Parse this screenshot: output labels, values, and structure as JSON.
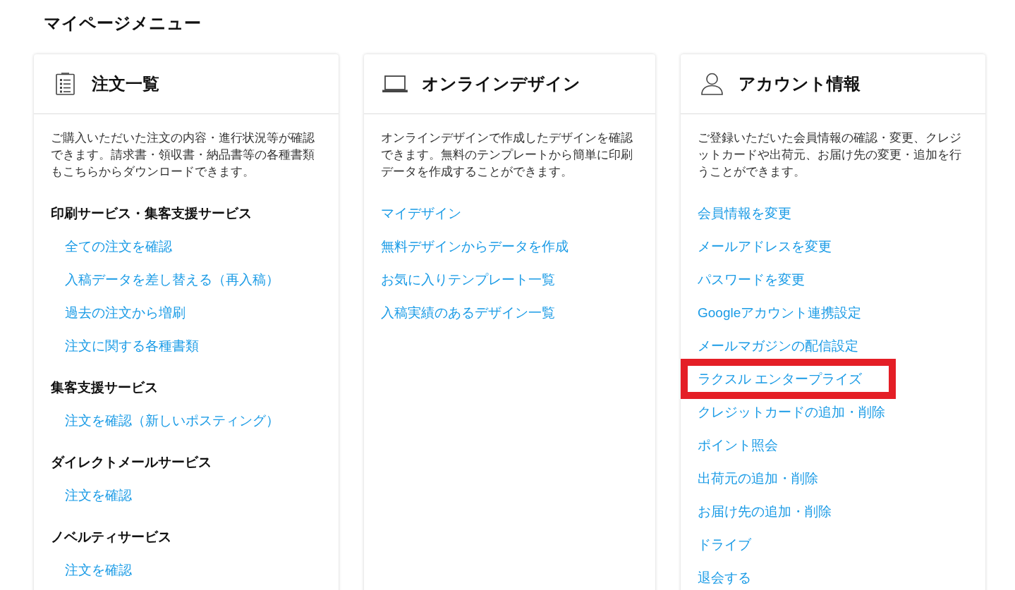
{
  "page_title": "マイページメニュー",
  "cards": [
    {
      "kind": "orders",
      "title": "注文一覧",
      "description": "ご購入いただいた注文の内容・進行状況等が確認できます。請求書・領収書・納品書等の各種書類もこちらからダウンロードできます。",
      "sections": [
        {
          "heading": "印刷サービス・集客支援サービス",
          "links": [
            {
              "label": "全ての注文を確認",
              "highlighted": false
            },
            {
              "label": "入稿データを差し替える（再入稿）",
              "highlighted": false
            },
            {
              "label": "過去の注文から増刷",
              "highlighted": false
            },
            {
              "label": "注文に関する各種書類",
              "highlighted": false
            }
          ]
        },
        {
          "heading": "集客支援サービス",
          "links": [
            {
              "label": "注文を確認（新しいポスティング）",
              "highlighted": false
            }
          ]
        },
        {
          "heading": "ダイレクトメールサービス",
          "links": [
            {
              "label": "注文を確認",
              "highlighted": false
            }
          ]
        },
        {
          "heading": "ノベルティサービス",
          "links": [
            {
              "label": "注文を確認",
              "highlighted": false
            }
          ]
        }
      ]
    },
    {
      "kind": "design",
      "title": "オンラインデザイン",
      "description": "オンラインデザインで作成したデザインを確認できます。無料のテンプレートから簡単に印刷データを作成することができます。",
      "links": [
        {
          "label": "マイデザイン",
          "highlighted": false
        },
        {
          "label": "無料デザインからデータを作成",
          "highlighted": false
        },
        {
          "label": "お気に入りテンプレート一覧",
          "highlighted": false
        },
        {
          "label": "入稿実績のあるデザイン一覧",
          "highlighted": false
        }
      ]
    },
    {
      "kind": "account",
      "title": "アカウント情報",
      "description": "ご登録いただいた会員情報の確認・変更、クレジットカードや出荷元、お届け先の変更・追加を行うことができます。",
      "links": [
        {
          "label": "会員情報を変更",
          "highlighted": false
        },
        {
          "label": "メールアドレスを変更",
          "highlighted": false
        },
        {
          "label": "パスワードを変更",
          "highlighted": false
        },
        {
          "label": "Googleアカウント連携設定",
          "highlighted": false
        },
        {
          "label": "メールマガジンの配信設定",
          "highlighted": false
        },
        {
          "label": "ラクスル エンタープライズ",
          "highlighted": true
        },
        {
          "label": "クレジットカードの追加・削除",
          "highlighted": false
        },
        {
          "label": "ポイント照会",
          "highlighted": false
        },
        {
          "label": "出荷元の追加・削除",
          "highlighted": false
        },
        {
          "label": "お届け先の追加・削除",
          "highlighted": false
        },
        {
          "label": "ドライブ",
          "highlighted": false
        },
        {
          "label": "退会する",
          "highlighted": false
        }
      ]
    }
  ]
}
